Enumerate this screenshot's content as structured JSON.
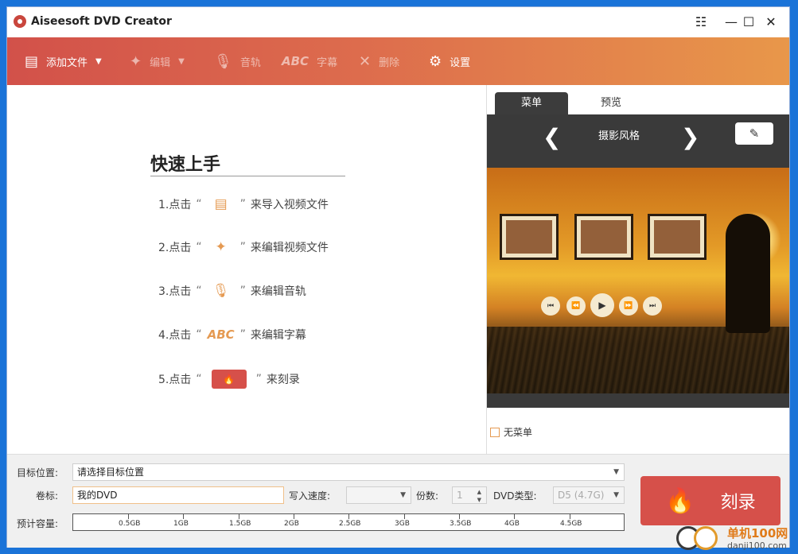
{
  "app": {
    "title": "Aiseesoft DVD Creator"
  },
  "titlebar": {
    "feedback_icon": "feedback-icon",
    "minimize": "—",
    "maximize": "☐",
    "close": "✕"
  },
  "toolbar": {
    "add_file": "添加文件",
    "edit": "编辑",
    "audio": "音轨",
    "subtitle": "字幕",
    "subtitle_icon_text": "ABC",
    "delete": "删除",
    "settings": "设置"
  },
  "quickstart": {
    "title": "快速上手",
    "open_quote": "“",
    "close_quote": "”",
    "steps": [
      {
        "prefix": "1.点击",
        "suffix": "来导入视频文件",
        "icon": "add-file-icon"
      },
      {
        "prefix": "2.点击",
        "suffix": "来编辑视频文件",
        "icon": "edit-stars-icon"
      },
      {
        "prefix": "3.点击",
        "suffix": "来编辑音轨",
        "icon": "mic-icon"
      },
      {
        "prefix": "4.点击",
        "suffix": "来编辑字幕",
        "icon": "abc-icon",
        "icon_text": "ABC"
      },
      {
        "prefix": "5.点击",
        "suffix": "来刻录",
        "icon": "burn-icon"
      }
    ]
  },
  "preview": {
    "tabs": [
      "菜单",
      "预览"
    ],
    "style_name": "摄影风格",
    "no_menu_label": "无菜单"
  },
  "bottom": {
    "target_label": "目标位置:",
    "target_value": "请选择目标位置",
    "volume_label": "卷标:",
    "volume_value": "我的DVD",
    "speed_label": "写入速度:",
    "speed_value": "",
    "copies_label": "份数:",
    "copies_value": "1",
    "dvd_type_label": "DVD类型:",
    "dvd_type_value": "D5 (4.7G)",
    "capacity_label": "预计容量:",
    "capacity_ticks": [
      "0.5GB",
      "1GB",
      "1.5GB",
      "2GB",
      "2.5GB",
      "3GB",
      "3.5GB",
      "4GB",
      "4.5GB"
    ],
    "capacity_used_fraction": 0,
    "burn_label": "刻录"
  },
  "watermark": {
    "line1": "单机100网",
    "line2": "danji100.com"
  },
  "colors": {
    "accent": "#d6504a",
    "toolbar_start": "#d2514a",
    "toolbar_end": "#e8974a",
    "icon_orange": "#e59a52"
  }
}
